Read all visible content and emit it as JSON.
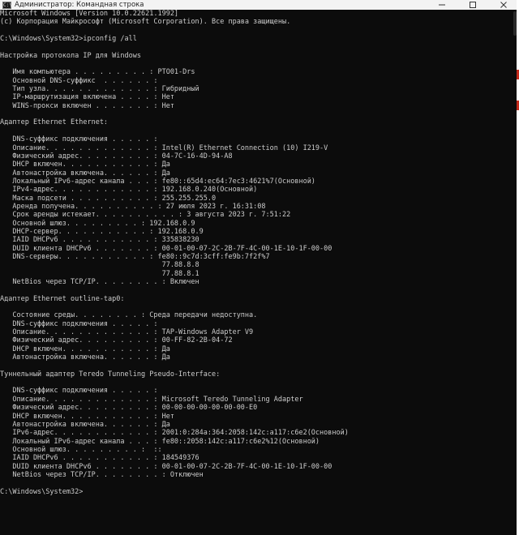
{
  "window": {
    "title": "Администратор: Командная строка",
    "icon_label": "C:\\"
  },
  "console_lines": [
    "Microsoft Windows [Version 10.0.22621.1992]",
    "(c) Корпорация Майкрософт (Microsoft Corporation). Все права защищены.",
    "",
    "C:\\Windows\\System32>ipconfig /all",
    "",
    "Настройка протокола IP для Windows",
    "",
    "   Имя компьютера . . . . . . . . . : PTO01-Drs",
    "   Основной DNS-суффикс  . . . . . . :",
    "   Тип узла. . . . . . . . . . . . . : Гибридный",
    "   IP-маршрутизация включена . . . . : Нет",
    "   WINS-прокси включен . . . . . . . : Нет",
    "",
    "Адаптер Ethernet Ethernet:",
    "",
    "   DNS-суффикс подключения . . . . . :",
    "   Описание. . . . . . . . . . . . . : Intel(R) Ethernet Connection (10) I219-V",
    "   Физический адрес. . . . . . . . . : 04-7C-16-4D-94-A8",
    "   DHCP включен. . . . . . . . . . . : Да",
    "   Автонастройка включена. . . . . . : Да",
    "   Локальный IPv6-адрес канала . . . : fe80::65d4:ec64:7ec3:4621%7(Основной)",
    "   IPv4-адрес. . . . . . . . . . . . : 192.168.0.240(Основной)",
    "   Маска подсети . . . . . . . . . . : 255.255.255.0",
    "   Аренда получена. . . . . . . . . . : 27 июля 2023 г. 16:31:08",
    "   Срок аренды истекает. . . . . . . . . . : 3 августа 2023 г. 7:51:22",
    "   Основной шлюз. . . . . . . . . : 192.168.0.9",
    "   DHCP-сервер. . . . . . . . . . . : 192.168.0.9",
    "   IAID DHCPv6 . . . . . . . . . . . : 335838230",
    "   DUID клиента DHCPv6 . . . . . . . : 00-01-00-07-2C-2B-7F-4C-00-1E-10-1F-00-00",
    "   DNS-серверы. . . . . . . . . . . : fe80::9c7d:3cff:fe9b:7f2f%7",
    "                                       77.88.8.8",
    "                                       77.88.8.1",
    "   NetBios через TCP/IP. . . . . . . . : Включен",
    "",
    "Адаптер Ethernet outline-tap0:",
    "",
    "   Состояние среды. . . . . . . . : Среда передачи недоступна.",
    "   DNS-суффикс подключения . . . . . :",
    "   Описание. . . . . . . . . . . . . : TAP-Windows Adapter V9",
    "   Физический адрес. . . . . . . . . : 00-FF-82-2B-04-72",
    "   DHCP включен. . . . . . . . . . . : Да",
    "   Автонастройка включена. . . . . . : Да",
    "",
    "Туннельный адаптер Teredo Tunneling Pseudo-Interface:",
    "",
    "   DNS-суффикс подключения . . . . . :",
    "   Описание. . . . . . . . . . . . . : Microsoft Teredo Tunneling Adapter",
    "   Физический адрес. . . . . . . . . : 00-00-00-00-00-00-00-E0",
    "   DHCP включен. . . . . . . . . . . : Нет",
    "   Автонастройка включена. . . . . . : Да",
    "   IPv6-адрес. . . . . . . . . . . . : 2001:0:284a:364:2058:142c:a117:c6e2(Основной)",
    "   Локальный IPv6-адрес канала . . . : fe80::2058:142c:a117:c6e2%12(Основной)",
    "   Основной шлюз. . . . . . . . . :  ::",
    "   IAID DHCPv6 . . . . . . . . . . . : 184549376",
    "   DUID клиента DHCPv6 . . . . . . . : 00-01-00-07-2C-2B-7F-4C-00-1E-10-1F-00-00",
    "   NetBios через TCP/IP. . . . . . . . : Отключен",
    "",
    "C:\\Windows\\System32>"
  ],
  "colors": {
    "console_bg": "#0c0c0c",
    "console_text": "#cccccc",
    "titlebar_bg": "#f3f3f3",
    "edge_accent": "#c42b1c"
  }
}
